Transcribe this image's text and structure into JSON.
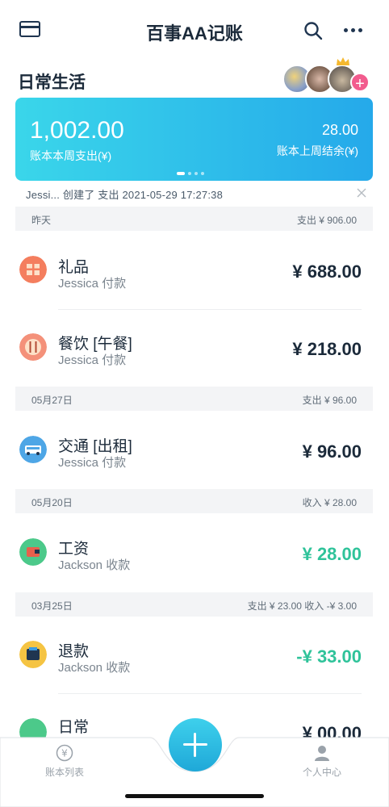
{
  "nav": {
    "title": "百事AA记账",
    "left_icon": "card-icon",
    "search_icon": "search-icon",
    "more_icon": "more-icon"
  },
  "book": {
    "name": "日常生活",
    "add_member": "+"
  },
  "banner": {
    "week_total": "1,002.00",
    "week_label": "账本本周支出(¥)",
    "last_balance": "28.00",
    "last_label": "账本上周结余(¥)",
    "page_count": 4,
    "active_page": 1
  },
  "activity": {
    "text": "Jessi...  创建了  支出    2021-05-29 17:27:38"
  },
  "sections": [
    {
      "date": "昨天",
      "summary": "支出 ¥ 906.00"
    },
    {
      "date": "05月27日",
      "summary": "支出 ¥ 96.00"
    },
    {
      "date": "05月20日",
      "summary": "收入 ¥ 28.00"
    },
    {
      "date": "03月25日",
      "summary": "支出 ¥ 23.00  收入 -¥ 3.00"
    }
  ],
  "records": [
    {
      "title": "礼品",
      "payer": "Jessica 付款",
      "amount": "¥ 688.00",
      "icon": "gift-icon",
      "color": "#f47e5e"
    },
    {
      "title": "餐饮 [午餐]",
      "payer": "Jessica 付款",
      "amount": "¥ 218.00",
      "icon": "dining-icon",
      "color": "#f4917a"
    },
    {
      "title": "交通 [出租]",
      "payer": "Jessica 付款",
      "amount": "¥ 96.00",
      "icon": "taxi-icon",
      "color": "#4ea6e6"
    },
    {
      "title": "工资",
      "payer": "Jackson 收款",
      "amount": "¥ 28.00",
      "icon": "salary-icon",
      "color": "#4cc98a"
    },
    {
      "title": "退款",
      "payer": "Jackson 收款",
      "amount": "-¥ 33.00",
      "icon": "refund-icon",
      "color": "#f5c443"
    },
    {
      "title": "日常",
      "payer": "",
      "amount": "¥ 00.00",
      "icon": "daily-icon",
      "color": "#4cc98a"
    }
  ],
  "tabbar": {
    "left_label": "账本列表",
    "right_label": "个人中心",
    "add_icon": "plus-icon"
  }
}
